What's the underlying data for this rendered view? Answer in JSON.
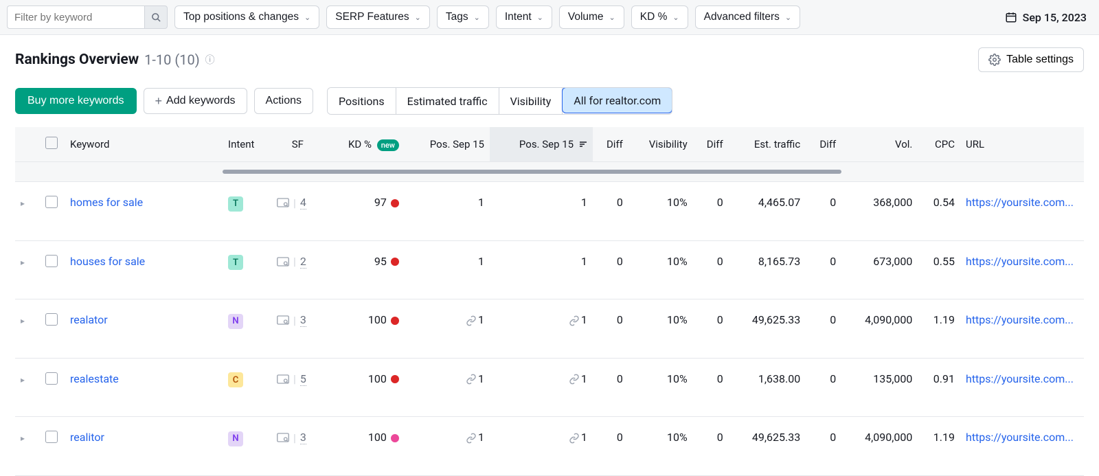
{
  "toolbar": {
    "search_placeholder": "Filter by keyword",
    "filters": [
      "Top positions & changes",
      "SERP Features",
      "Tags",
      "Intent",
      "Volume",
      "KD %",
      "Advanced filters"
    ],
    "date": "Sep 15, 2023"
  },
  "panel": {
    "title": "Rankings Overview",
    "range": "1-10 (10)",
    "table_settings": "Table settings"
  },
  "actions": {
    "buy_more": "Buy more keywords",
    "add_keywords": "Add keywords",
    "actions_label": "Actions",
    "tabs": [
      "Positions",
      "Estimated traffic",
      "Visibility",
      "All for realtor.com"
    ],
    "active_tab": 3
  },
  "columns": {
    "keyword": "Keyword",
    "intent": "Intent",
    "sf": "SF",
    "kd": "KD %",
    "kd_new": "new",
    "pos1": "Pos. Sep 15",
    "pos2": "Pos. Sep 15",
    "diff1": "Diff",
    "visibility": "Visibility",
    "diff2": "Diff",
    "est_traffic": "Est. traffic",
    "diff3": "Diff",
    "vol": "Vol.",
    "cpc": "CPC",
    "url": "URL"
  },
  "rows": [
    {
      "kw": "homes for sale",
      "intent": "T",
      "sf": "4",
      "kd": "97",
      "kd_color": "red",
      "pos1": "1",
      "pos1_link": false,
      "pos2": "1",
      "pos2_link": false,
      "diff1": "0",
      "vis": "10%",
      "diff2": "0",
      "traffic": "4,465.07",
      "diff3": "0",
      "vol": "368,000",
      "cpc": "0.54",
      "url": "https://yoursite.com..."
    },
    {
      "kw": "houses for sale",
      "intent": "T",
      "sf": "2",
      "kd": "95",
      "kd_color": "red",
      "pos1": "1",
      "pos1_link": false,
      "pos2": "1",
      "pos2_link": false,
      "diff1": "0",
      "vis": "10%",
      "diff2": "0",
      "traffic": "8,165.73",
      "diff3": "0",
      "vol": "673,000",
      "cpc": "0.55",
      "url": "https://yoursite.com..."
    },
    {
      "kw": "realator",
      "intent": "N",
      "sf": "3",
      "kd": "100",
      "kd_color": "red",
      "pos1": "1",
      "pos1_link": true,
      "pos2": "1",
      "pos2_link": true,
      "diff1": "0",
      "vis": "10%",
      "diff2": "0",
      "traffic": "49,625.33",
      "diff3": "0",
      "vol": "4,090,000",
      "cpc": "1.19",
      "url": "https://yoursite.com..."
    },
    {
      "kw": "realestate",
      "intent": "C",
      "sf": "5",
      "kd": "100",
      "kd_color": "red",
      "pos1": "1",
      "pos1_link": true,
      "pos2": "1",
      "pos2_link": true,
      "diff1": "0",
      "vis": "10%",
      "diff2": "0",
      "traffic": "1,638.00",
      "diff3": "0",
      "vol": "135,000",
      "cpc": "0.91",
      "url": "https://yoursite.com..."
    },
    {
      "kw": "realitor",
      "intent": "N",
      "sf": "3",
      "kd": "100",
      "kd_color": "pink",
      "pos1": "1",
      "pos1_link": true,
      "pos2": "1",
      "pos2_link": true,
      "diff1": "0",
      "vis": "10%",
      "diff2": "0",
      "traffic": "49,625.33",
      "diff3": "0",
      "vol": "4,090,000",
      "cpc": "1.19",
      "url": "https://yoursite.com..."
    }
  ]
}
